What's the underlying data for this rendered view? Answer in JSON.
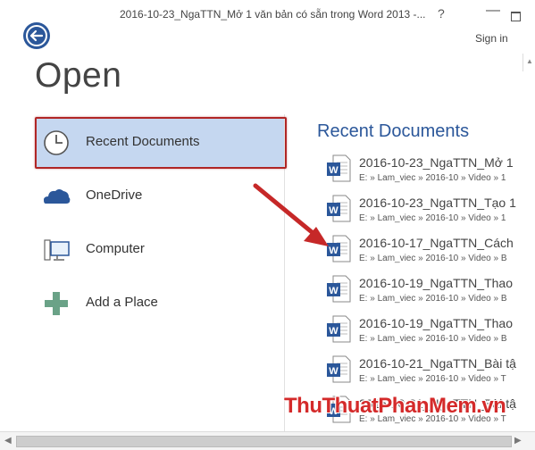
{
  "window": {
    "title": "2016-10-23_NgaTTN_Mở 1 văn bản có sẵn trong Word 2013 -...",
    "help_label": "?",
    "minimize_label": "—",
    "signin_label": "Sign in"
  },
  "page": {
    "title": "Open"
  },
  "places": [
    {
      "label": "Recent Documents",
      "icon": "clock-icon"
    },
    {
      "label": "OneDrive",
      "icon": "cloud-icon"
    },
    {
      "label": "Computer",
      "icon": "computer-icon"
    },
    {
      "label": "Add a Place",
      "icon": "plus-icon"
    }
  ],
  "recent": {
    "title": "Recent Documents",
    "items": [
      {
        "name": "2016-10-23_NgaTTN_Mở 1",
        "path": "E: » Lam_viec » 2016-10 » Video » 1"
      },
      {
        "name": "2016-10-23_NgaTTN_Tạo 1",
        "path": "E: » Lam_viec » 2016-10 » Video » 1"
      },
      {
        "name": "2016-10-17_NgaTTN_Cách",
        "path": "E: » Lam_viec » 2016-10 » Video » B"
      },
      {
        "name": "2016-10-19_NgaTTN_Thao",
        "path": "E: » Lam_viec » 2016-10 » Video » B"
      },
      {
        "name": "2016-10-19_NgaTTN_Thao",
        "path": "E: » Lam_viec » 2016-10 » Video » B"
      },
      {
        "name": "2016-10-21_NgaTTN_Bài tậ",
        "path": "E: » Lam_viec » 2016-10 » Video » T"
      },
      {
        "name": "2016-10-21_NgaTTN_Bài tậ",
        "path": "E: » Lam_viec » 2016-10 » Video » T"
      }
    ]
  },
  "watermark": "ThuThuatPhanMem.vn",
  "colors": {
    "accent": "#2b579a",
    "selected": "#c5d7f0",
    "highlight": "#b02626",
    "watermark": "#d42a2a"
  }
}
